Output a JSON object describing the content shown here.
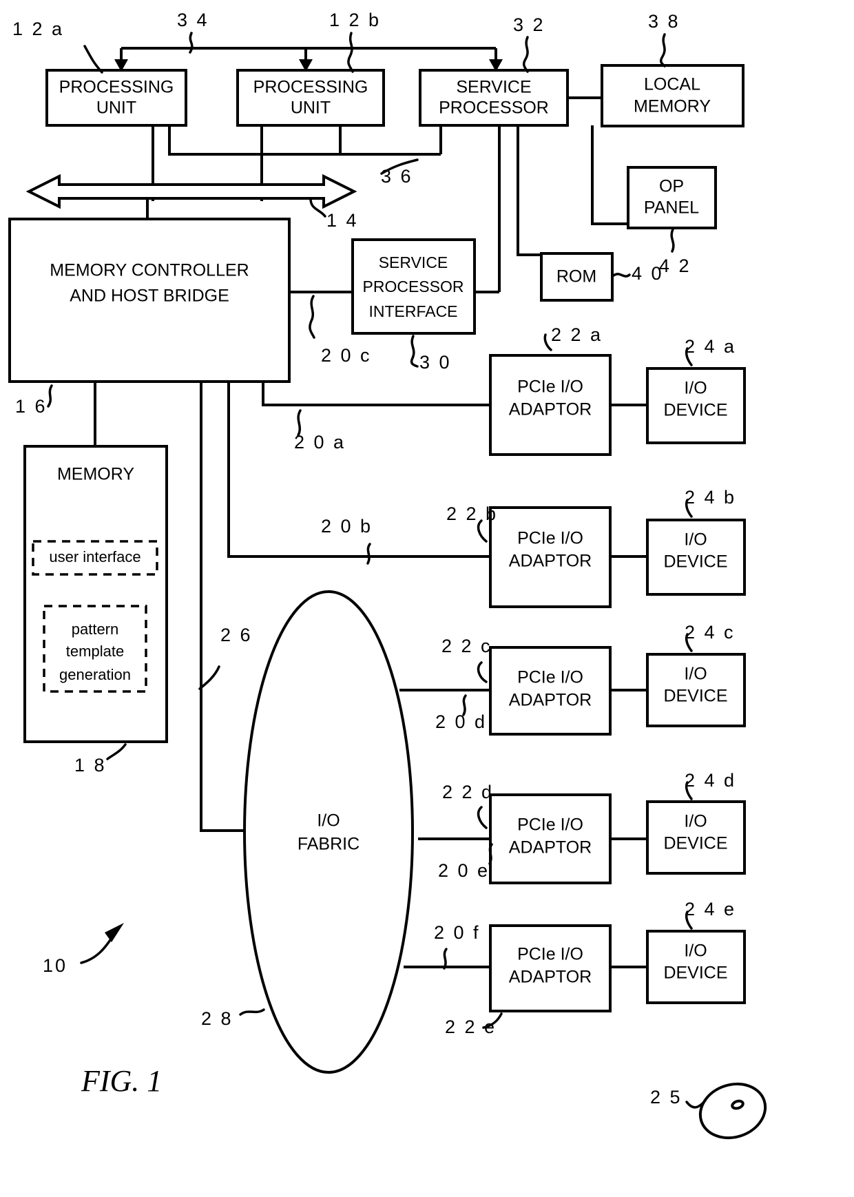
{
  "figure": {
    "caption": "FIG. 1",
    "system_ref": "10"
  },
  "blocks": {
    "processing_unit_a": {
      "line1": "PROCESSING",
      "line2": "UNIT",
      "ref": "1 2 a"
    },
    "processing_unit_b": {
      "line1": "PROCESSING",
      "line2": "UNIT",
      "ref": "1 2 b"
    },
    "service_processor": {
      "line1": "SERVICE",
      "line2": "PROCESSOR",
      "ref": "3 2"
    },
    "local_memory": {
      "line1": "LOCAL",
      "line2": "MEMORY",
      "ref": "3 8"
    },
    "op_panel": {
      "line1": "OP",
      "line2": "PANEL",
      "ref": "4 2"
    },
    "rom": {
      "line1": "ROM",
      "ref": "4 0"
    },
    "memory_controller": {
      "line1": "MEMORY CONTROLLER",
      "line2": "AND HOST BRIDGE",
      "ref": "1 6"
    },
    "service_processor_interface": {
      "line1": "SERVICE",
      "line2": "PROCESSOR",
      "line3": "INTERFACE",
      "ref": "3 0"
    },
    "memory": {
      "title": "MEMORY",
      "ref": "1 8",
      "modules": [
        {
          "lines": [
            "user interface"
          ]
        },
        {
          "lines": [
            "pattern",
            "template",
            "generation"
          ]
        }
      ]
    },
    "io_fabric": {
      "line1": "I/O",
      "line2": "FABRIC",
      "ref": "2 8"
    },
    "mouse_device": {
      "ref": "2 5"
    }
  },
  "buses": {
    "interrupt_bus": {
      "ref": "3 4"
    },
    "service_bus": {
      "ref": "3 6"
    },
    "system_bus": {
      "ref": "1 4"
    },
    "fabric_link": {
      "ref": "2 6"
    },
    "link_20a": {
      "ref": "2 0 a"
    },
    "link_20b": {
      "ref": "2 0 b"
    },
    "link_20c": {
      "ref": "2 0 c"
    },
    "link_20d": {
      "ref": "2 0 d"
    },
    "link_20e": {
      "ref": "2 0 e"
    },
    "link_20f": {
      "ref": "2 0 f"
    }
  },
  "io_rows": [
    {
      "adaptor_line1": "PCIe I/O",
      "adaptor_line2": "ADAPTOR",
      "adaptor_ref": "2 2 a",
      "device_line1": "I/O",
      "device_line2": "DEVICE",
      "device_ref": "2 4 a",
      "link_ref": "2 0 a"
    },
    {
      "adaptor_line1": "PCIe I/O",
      "adaptor_line2": "ADAPTOR",
      "adaptor_ref": "2 2 b",
      "device_line1": "I/O",
      "device_line2": "DEVICE",
      "device_ref": "2 4 b",
      "link_ref": "2 0 b"
    },
    {
      "adaptor_line1": "PCIe I/O",
      "adaptor_line2": "ADAPTOR",
      "adaptor_ref": "2 2 c",
      "device_line1": "I/O",
      "device_line2": "DEVICE",
      "device_ref": "2 4 c",
      "link_ref": "2 0 d"
    },
    {
      "adaptor_line1": "PCIe I/O",
      "adaptor_line2": "ADAPTOR",
      "adaptor_ref": "2 2 d",
      "device_line1": "I/O",
      "device_line2": "DEVICE",
      "device_ref": "2 4 d",
      "link_ref": "2 0 e"
    },
    {
      "adaptor_line1": "PCIe I/O",
      "adaptor_line2": "ADAPTOR",
      "adaptor_ref": "2 2 e",
      "device_line1": "I/O",
      "device_line2": "DEVICE",
      "device_ref": "2 4 e",
      "link_ref": "2 0 f"
    }
  ],
  "colors": {
    "line": "#000000",
    "fill": "#ffffff"
  }
}
